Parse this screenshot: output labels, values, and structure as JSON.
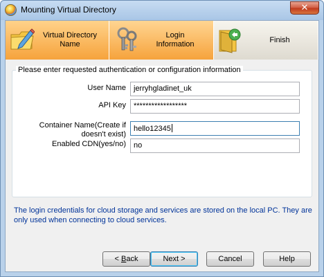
{
  "window": {
    "title": "Mounting Virtual Directory",
    "close_icon": "close-icon",
    "app_icon": "app-icon"
  },
  "steps": [
    {
      "label_line1": "Virtual Directory",
      "label_line2": "Name",
      "icon": "folder-edit-icon",
      "state": "completed"
    },
    {
      "label_line1": "Login",
      "label_line2": "Information",
      "icon": "keys-icon",
      "state": "current"
    },
    {
      "label_line1": "Finish",
      "label_line2": "",
      "icon": "finish-folder-icon",
      "state": "pending"
    }
  ],
  "form": {
    "group_title": "Please enter requested authentication or configuration information",
    "fields": [
      {
        "label_line1": "User Name",
        "label_line2": "",
        "value": "jerryhgladinet_uk"
      },
      {
        "label_line1": "API Key",
        "label_line2": "",
        "value": "******************"
      },
      {
        "label_line1": "Container Name(Create if",
        "label_line2": "doesn't exist)",
        "value": "hello12345"
      },
      {
        "label_line1": "Enabled CDN(yes/no)",
        "label_line2": "",
        "value": "no"
      }
    ]
  },
  "info": "The login credentials for cloud storage and services are stored on the local PC. They are only used when connecting to cloud services.",
  "buttons": {
    "back_prefix": "< ",
    "back_mnemonic": "B",
    "back_suffix": "ack",
    "next": "Next >",
    "cancel": "Cancel",
    "help": "Help"
  },
  "colors": {
    "step_active": "#f6a33c",
    "step_pending": "#dedad0",
    "info_text": "#003399",
    "title_bar": "#b9d1ea"
  }
}
